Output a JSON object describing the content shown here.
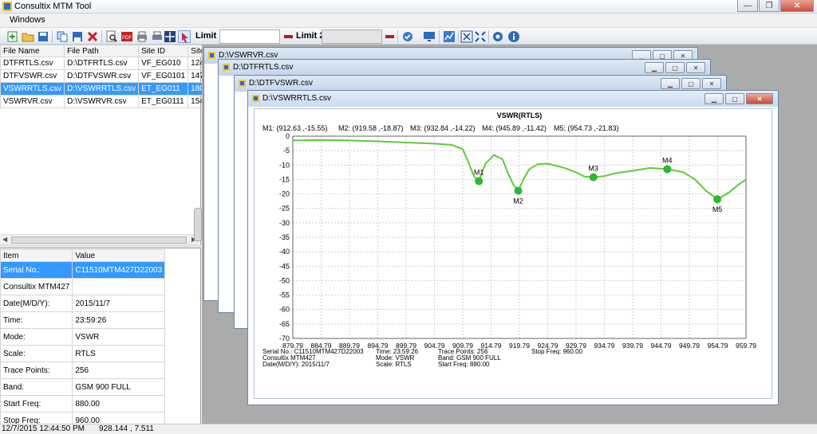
{
  "window": {
    "title": "Consultix MTM Tool",
    "min": "—",
    "max": "❐",
    "close": "✕"
  },
  "menu": {
    "windows": "Windows"
  },
  "toolbar": {
    "limit1_label": "Limit 1",
    "limit1_value": "",
    "limit2_label": "Limit 2",
    "limit2_value": "",
    "icons": [
      "new-icon",
      "open-icon",
      "save-icon",
      "copy-icon",
      "save-as-icon",
      "delete-icon",
      "zoom-icon",
      "pdf-icon",
      "print-icon",
      "print-preview-icon",
      "grid-icon",
      "cursor-icon",
      "measure-icon",
      "monitor-icon",
      "chart-icon",
      "fit-icon",
      "shrink-icon",
      "settings-icon",
      "info-icon"
    ],
    "colors": {
      "limit_marker": "#c0151b"
    }
  },
  "files": {
    "headers": [
      "File Name",
      "File Path",
      "Site ID",
      "Site NO"
    ],
    "rows": [
      [
        "DTFRTLS.csv",
        "D:\\DTFRTLS.csv",
        "VF_EG010",
        "1245"
      ],
      [
        "DTFVSWR.csv",
        "D:\\DTFVSWR.csv",
        "VF_EG0101",
        "1470"
      ],
      [
        "VSWRRTLS.csv",
        "D:\\VSWRRTLS.csv",
        "ET_EG011",
        "1801"
      ],
      [
        "VSWRVR.csv",
        "D:\\VSWRVR.csv",
        "ET_EG0111",
        "1549"
      ]
    ],
    "selected_index": 2
  },
  "info": {
    "headers": [
      "Item",
      "Value"
    ],
    "rows": [
      [
        "Serial No.:",
        "C11510MTM427D22003"
      ],
      [
        "Consultix MTM427",
        ""
      ],
      [
        "Date(M/D/Y):",
        "2015/11/7"
      ],
      [
        "Time:",
        "23:59:26"
      ],
      [
        "Mode:",
        "VSWR"
      ],
      [
        "Scale:",
        "RTLS"
      ],
      [
        "Trace Points:",
        "256"
      ],
      [
        "Band:",
        "GSM 900 FULL"
      ],
      [
        "Start Freq:",
        "880.00"
      ],
      [
        "Stop Freq:",
        "960.00"
      ]
    ]
  },
  "windows": {
    "w1": "D:\\VSWRVR.csv",
    "w2": "D:\\DTFRTLS.csv",
    "w3": "D:\\DTFVSWR.csv",
    "w4": "D:\\VSWRRTLS.csv"
  },
  "chart_data": {
    "type": "line",
    "title": "VSWR(RTLS)",
    "markers_readout": [
      "M1: (912.63 ,-15.55)",
      "M2: (919.58 ,-18.87)",
      "M3: (932.84 ,-14.22)",
      "M4: (945.89 ,-11.42)",
      "M5: (954.73 ,-21.83)"
    ],
    "markers": [
      {
        "label": "M1",
        "x": 912.63,
        "y": -15.55
      },
      {
        "label": "M2",
        "x": 919.58,
        "y": -18.87
      },
      {
        "label": "M3",
        "x": 932.84,
        "y": -14.22
      },
      {
        "label": "M4",
        "x": 945.89,
        "y": -11.42
      },
      {
        "label": "M5",
        "x": 954.73,
        "y": -21.83
      }
    ],
    "xlim": [
      879.79,
      959.79
    ],
    "ylim": [
      -70,
      0
    ],
    "xticks": [
      "879.79",
      "884.79",
      "889.79",
      "894.79",
      "899.79",
      "904.79",
      "909.79",
      "914.79",
      "919.79",
      "924.79",
      "929.79",
      "934.79",
      "939.79",
      "944.79",
      "949.79",
      "954.79",
      "959.79"
    ],
    "yticks": [
      "0",
      "-5",
      "-10",
      "-15",
      "-20",
      "-25",
      "-30",
      "-35",
      "-40",
      "-45",
      "-50",
      "-55",
      "-60",
      "-65",
      "-70"
    ],
    "grid": true,
    "line_color": "#5ecb3c",
    "marker_color": "#2db82d",
    "x": [
      879.79,
      884.79,
      889.79,
      894.79,
      899.79,
      904.79,
      907.79,
      909.79,
      910.79,
      911.79,
      912.63,
      913.8,
      915.3,
      916.8,
      917.8,
      918.79,
      919.58,
      920.5,
      921.5,
      923.0,
      924.79,
      927.79,
      929.79,
      931.3,
      932.84,
      934.79,
      936.79,
      939.79,
      942.79,
      945.89,
      948.79,
      950.79,
      952.79,
      954.73,
      956.79,
      958.3,
      959.79
    ],
    "y": [
      -1.5,
      -1.3,
      -1.5,
      -1.8,
      -2.2,
      -2.6,
      -3.0,
      -4.5,
      -9.0,
      -14.0,
      -15.55,
      -9.5,
      -6.5,
      -8.0,
      -13.0,
      -17.0,
      -18.87,
      -15.0,
      -11.5,
      -9.7,
      -9.5,
      -11.0,
      -12.5,
      -14.0,
      -14.22,
      -13.8,
      -12.8,
      -12.0,
      -11.0,
      -11.42,
      -12.5,
      -15.0,
      -19.0,
      -21.83,
      -19.5,
      -17.0,
      -15.0
    ],
    "footer": {
      "col1": [
        "Serial No.: C11510MTM427D22003",
        "Consultix MTM427",
        "Date(M/D/Y): 2015/11/7"
      ],
      "col2": [
        "Time: 23:59:26",
        "Mode: VSWR",
        "Scale: RTLS"
      ],
      "col3": [
        "Trace Points: 256",
        "Band: GSM 900 FULL",
        "Start Freq: 880.00"
      ],
      "col4": [
        "Stop Freq: 960.00"
      ]
    }
  },
  "status": {
    "datetime": "12/7/2015 12:44:50 PM",
    "coords": "928.144  , 7.511"
  }
}
